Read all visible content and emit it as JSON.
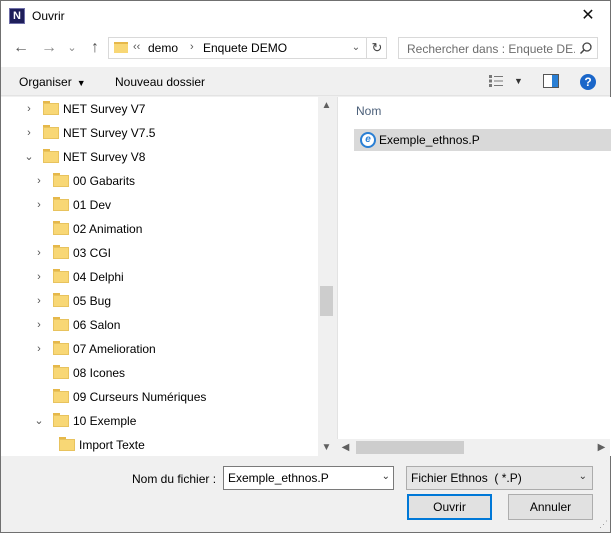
{
  "window": {
    "title": "Ouvrir",
    "app_icon_letter": "N",
    "close": "✕"
  },
  "nav": {
    "back": "←",
    "forward": "→",
    "recent": "⌄",
    "up": "↑",
    "breadcrumb_prefix": "‹‹",
    "breadcrumb": [
      "demo",
      "Enquete DEMO"
    ],
    "separator": "›",
    "dropdown": "⌄",
    "refresh": "↻"
  },
  "search": {
    "placeholder": "Rechercher dans : Enquete DE..."
  },
  "toolbar": {
    "organize_label": "Organiser",
    "new_folder_label": "Nouveau dossier",
    "help": "?"
  },
  "tree": [
    {
      "label": "NET Survey V7",
      "level": 0,
      "chevron": "›"
    },
    {
      "label": "NET Survey V7.5",
      "level": 0,
      "chevron": "›"
    },
    {
      "label": "NET Survey V8",
      "level": 0,
      "chevron": "⌄"
    },
    {
      "label": "00 Gabarits",
      "level": 1,
      "chevron": "›"
    },
    {
      "label": "01 Dev",
      "level": 1,
      "chevron": "›"
    },
    {
      "label": "02 Animation",
      "level": 1,
      "chevron": ""
    },
    {
      "label": "03 CGI",
      "level": 1,
      "chevron": "›"
    },
    {
      "label": "04 Delphi",
      "level": 1,
      "chevron": "›"
    },
    {
      "label": "05 Bug",
      "level": 1,
      "chevron": "›"
    },
    {
      "label": "06 Salon",
      "level": 1,
      "chevron": "›"
    },
    {
      "label": "07 Amelioration",
      "level": 1,
      "chevron": "›"
    },
    {
      "label": "08 Icones",
      "level": 1,
      "chevron": ""
    },
    {
      "label": "09 Curseurs Numériques",
      "level": 1,
      "chevron": ""
    },
    {
      "label": "10 Exemple",
      "level": 1,
      "chevron": "⌄"
    },
    {
      "label": "Import Texte",
      "level": 2,
      "chevron": ""
    }
  ],
  "files": {
    "column_header": "Nom",
    "items": [
      {
        "name": "Exemple_ethnos.P",
        "icon": "e-icon",
        "selected": true
      }
    ]
  },
  "footer": {
    "filename_label": "Nom du fichier :",
    "filename_value": "Exemple_ethnos.P",
    "filter_value": "Fichier Ethnos  ( *.P)",
    "open_label": "Ouvrir",
    "cancel_label": "Annuler"
  },
  "colors": {
    "selected_row": "#d9d9d9",
    "primary_border": "#0078d7",
    "folder": "#f8d775",
    "help": "#1a66c9"
  }
}
